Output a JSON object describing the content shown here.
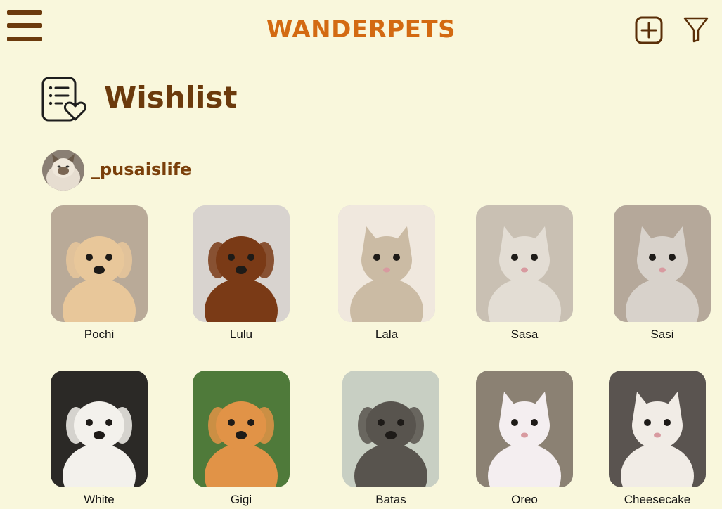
{
  "header": {
    "app_title": "WANDERPETS"
  },
  "page": {
    "title": "Wishlist"
  },
  "profile": {
    "username": "_pusaislife"
  },
  "pets": [
    {
      "name": "Pochi",
      "bg": "#b9aa98",
      "fur": "#e8c79a",
      "kind": "dog"
    },
    {
      "name": "Lulu",
      "bg": "#d8d3cf",
      "fur": "#7a3a16",
      "kind": "dog"
    },
    {
      "name": "Lala",
      "bg": "#f0e8de",
      "fur": "#cbbba4",
      "kind": "cat"
    },
    {
      "name": "Sasa",
      "bg": "#c9c0b3",
      "fur": "#e3ddd4",
      "kind": "cat"
    },
    {
      "name": "Sasi",
      "bg": "#b5a89a",
      "fur": "#d8d2cb",
      "kind": "cat"
    },
    {
      "name": "White",
      "bg": "#2b2926",
      "fur": "#f3f1ec",
      "kind": "dog"
    },
    {
      "name": "Gigi",
      "bg": "#4f7a3a",
      "fur": "#e19347",
      "kind": "dog"
    },
    {
      "name": "Batas",
      "bg": "#c8cfc3",
      "fur": "#58544e",
      "kind": "dog"
    },
    {
      "name": "Oreo",
      "bg": "#8b8173",
      "fur": "#f4eef0",
      "kind": "cat"
    },
    {
      "name": "Cheesecake",
      "bg": "#5a5450",
      "fur": "#f1ece6",
      "kind": "cat"
    }
  ]
}
